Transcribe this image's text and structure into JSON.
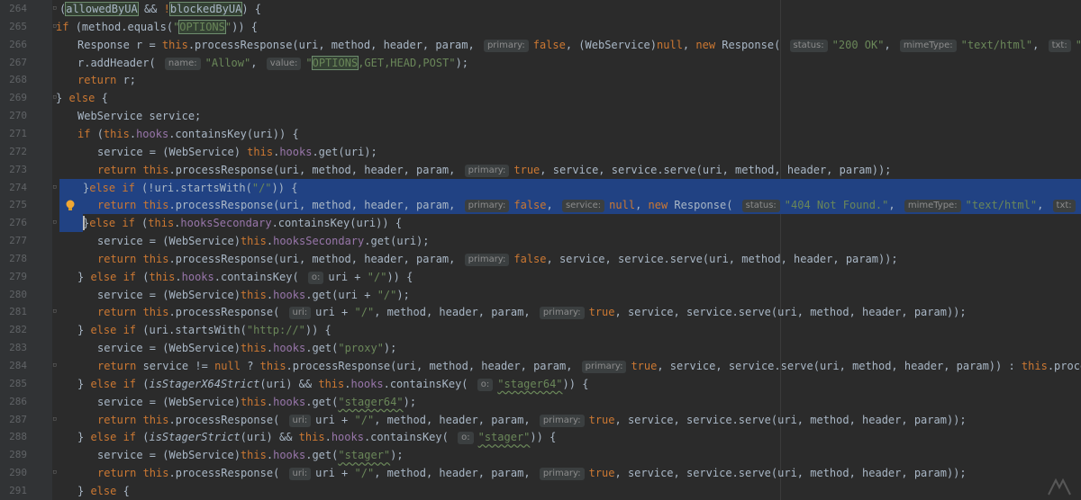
{
  "editor": {
    "lines": [
      {
        "num": "264",
        "t": [
          [
            "plain",
            "("
          ],
          [
            "boxed",
            "allowedByUA"
          ],
          [
            "plain",
            " && "
          ],
          [
            "kw",
            "!"
          ],
          [
            "boxed",
            "blockedByUA"
          ],
          [
            "plain",
            ") {"
          ]
        ]
      },
      {
        "num": "265",
        "t": [
          [
            "kw",
            "if "
          ],
          [
            "plain",
            "(method.equals("
          ],
          [
            "str",
            "\""
          ],
          [
            "str boxed",
            "OPTIONS"
          ],
          [
            "str",
            "\""
          ],
          [
            "plain",
            ")) {"
          ]
        ]
      },
      {
        "num": "266",
        "t": [
          [
            "plain",
            "Response r = "
          ],
          [
            "kw",
            "this"
          ],
          [
            "plain",
            ".processResponse(uri, method, header, param, "
          ],
          [
            "hint",
            "primary:"
          ],
          [
            "kw",
            "false"
          ],
          [
            "plain",
            ", ("
          ],
          [
            "plain",
            "WebService"
          ],
          [
            "plain",
            ")"
          ],
          [
            "kw",
            "null"
          ],
          [
            "plain",
            ", "
          ],
          [
            "kw",
            "new "
          ],
          [
            "plain",
            "Response( "
          ],
          [
            "hint",
            "status:"
          ],
          [
            "str",
            "\"200 OK\""
          ],
          [
            "plain",
            ", "
          ],
          [
            "hint",
            "mimeType:"
          ],
          [
            "str",
            "\"text/html\""
          ],
          [
            "plain",
            ", "
          ],
          [
            "hint",
            "txt:"
          ],
          [
            "str",
            "\"\""
          ],
          [
            "plain",
            "));"
          ]
        ]
      },
      {
        "num": "267",
        "t": [
          [
            "plain",
            "r.addHeader( "
          ],
          [
            "hint",
            "name:"
          ],
          [
            "str",
            "\"Allow\""
          ],
          [
            "plain",
            ", "
          ],
          [
            "hint",
            "value:"
          ],
          [
            "str",
            "\""
          ],
          [
            "str boxed",
            "OPTIONS"
          ],
          [
            "str",
            ",GET,HEAD,POST\""
          ],
          [
            "plain",
            ");"
          ]
        ]
      },
      {
        "num": "268",
        "t": [
          [
            "kw",
            "return "
          ],
          [
            "plain",
            "r;"
          ]
        ]
      },
      {
        "num": "269",
        "t": [
          [
            "plain",
            "} "
          ],
          [
            "kw",
            "else "
          ],
          [
            "plain",
            "{"
          ]
        ]
      },
      {
        "num": "270",
        "t": [
          [
            "plain",
            "WebService service;"
          ]
        ]
      },
      {
        "num": "271",
        "t": [
          [
            "kw",
            "if "
          ],
          [
            "plain",
            "("
          ],
          [
            "kw",
            "this"
          ],
          [
            "plain",
            "."
          ],
          [
            "fld",
            "hooks"
          ],
          [
            "plain",
            ".containsKey(uri)) {"
          ]
        ]
      },
      {
        "num": "272",
        "t": [
          [
            "plain",
            "service = (WebService) "
          ],
          [
            "kw",
            "this"
          ],
          [
            "plain",
            "."
          ],
          [
            "fld",
            "hooks"
          ],
          [
            "plain",
            ".get(uri);"
          ]
        ]
      },
      {
        "num": "273",
        "t": [
          [
            "kw",
            "return this"
          ],
          [
            "plain",
            ".processResponse(uri, method, header, param, "
          ],
          [
            "hint",
            "primary:"
          ],
          [
            "kw",
            "true"
          ],
          [
            "plain",
            ", service, service.serve(uri, method, header, param));"
          ]
        ]
      },
      {
        "num": "274",
        "t": [
          [
            "plain",
            "}"
          ],
          [
            "kw",
            "else if "
          ],
          [
            "plain",
            "(!uri.startsWith("
          ],
          [
            "str",
            "\"/\""
          ],
          [
            "plain",
            ")) {"
          ]
        ]
      },
      {
        "num": "275",
        "t": [
          [
            "kw",
            "return this"
          ],
          [
            "plain",
            ".processResponse(uri, method, header, param, "
          ],
          [
            "hint",
            "primary:"
          ],
          [
            "kw",
            "false"
          ],
          [
            "plain",
            ", "
          ],
          [
            "hint",
            "service:"
          ],
          [
            "kw",
            "null"
          ],
          [
            "plain",
            ", "
          ],
          [
            "kw",
            "new "
          ],
          [
            "plain",
            "Response( "
          ],
          [
            "hint",
            "status:"
          ],
          [
            "str",
            "\"404 Not Found.\""
          ],
          [
            "plain",
            ", "
          ],
          [
            "hint",
            "mimeType:"
          ],
          [
            "str",
            "\"text/html\""
          ],
          [
            "plain",
            ", "
          ],
          [
            "hint",
            "txt:"
          ],
          [
            "str",
            "\"\""
          ],
          [
            "plain",
            "));"
          ]
        ]
      },
      {
        "num": "276",
        "t": [
          [
            "plain",
            "}"
          ],
          [
            "kw",
            "else if "
          ],
          [
            "plain",
            "("
          ],
          [
            "kw",
            "this"
          ],
          [
            "plain",
            "."
          ],
          [
            "fld",
            "hooksSecondary"
          ],
          [
            "plain",
            ".containsKey(uri)) {"
          ]
        ]
      },
      {
        "num": "277",
        "t": [
          [
            "plain",
            "service = (WebService)"
          ],
          [
            "kw",
            "this"
          ],
          [
            "plain",
            "."
          ],
          [
            "fld",
            "hooksSecondary"
          ],
          [
            "plain",
            ".get(uri);"
          ]
        ]
      },
      {
        "num": "278",
        "t": [
          [
            "kw",
            "return this"
          ],
          [
            "plain",
            ".processResponse(uri, method, header, param, "
          ],
          [
            "hint",
            "primary:"
          ],
          [
            "kw",
            "false"
          ],
          [
            "plain",
            ", service, service.serve(uri, method, header, param));"
          ]
        ]
      },
      {
        "num": "279",
        "t": [
          [
            "plain",
            "} "
          ],
          [
            "kw",
            "else if "
          ],
          [
            "plain",
            "("
          ],
          [
            "kw",
            "this"
          ],
          [
            "plain",
            "."
          ],
          [
            "fld",
            "hooks"
          ],
          [
            "plain",
            ".containsKey( "
          ],
          [
            "hint",
            "o:"
          ],
          [
            "plain",
            "uri + "
          ],
          [
            "str",
            "\"/\""
          ],
          [
            "plain",
            ")) {"
          ]
        ]
      },
      {
        "num": "280",
        "t": [
          [
            "plain",
            "service = (WebService)"
          ],
          [
            "kw",
            "this"
          ],
          [
            "plain",
            "."
          ],
          [
            "fld",
            "hooks"
          ],
          [
            "plain",
            ".get(uri + "
          ],
          [
            "str",
            "\"/\""
          ],
          [
            "plain",
            ");"
          ]
        ]
      },
      {
        "num": "281",
        "t": [
          [
            "kw",
            "return this"
          ],
          [
            "plain",
            ".processResponse( "
          ],
          [
            "hint",
            "uri:"
          ],
          [
            "plain",
            "uri + "
          ],
          [
            "str",
            "\"/\""
          ],
          [
            "plain",
            ", method, header, param, "
          ],
          [
            "hint",
            "primary:"
          ],
          [
            "kw",
            "true"
          ],
          [
            "plain",
            ", service, service.serve(uri, method, header, param));"
          ]
        ]
      },
      {
        "num": "282",
        "t": [
          [
            "plain",
            "} "
          ],
          [
            "kw",
            "else if "
          ],
          [
            "plain",
            "(uri.startsWith("
          ],
          [
            "str",
            "\"http://\""
          ],
          [
            "plain",
            ")) {"
          ]
        ]
      },
      {
        "num": "283",
        "t": [
          [
            "plain",
            "service = (WebService)"
          ],
          [
            "kw",
            "this"
          ],
          [
            "plain",
            "."
          ],
          [
            "fld",
            "hooks"
          ],
          [
            "plain",
            ".get("
          ],
          [
            "str",
            "\"proxy\""
          ],
          [
            "plain",
            ");"
          ]
        ]
      },
      {
        "num": "284",
        "t": [
          [
            "kw",
            "return "
          ],
          [
            "plain",
            "service != "
          ],
          [
            "kw",
            "null "
          ],
          [
            "plain",
            "? "
          ],
          [
            "kw",
            "this"
          ],
          [
            "plain",
            ".processResponse(uri, method, header, param, "
          ],
          [
            "hint",
            "primary:"
          ],
          [
            "kw",
            "true"
          ],
          [
            "plain",
            ", service, service.serve(uri, method, header, param)) : "
          ],
          [
            "kw",
            "this"
          ],
          [
            "plain",
            ".proce"
          ]
        ]
      },
      {
        "num": "285",
        "t": [
          [
            "plain",
            "} "
          ],
          [
            "kw",
            "else if "
          ],
          [
            "plain",
            "("
          ],
          [
            "ital",
            "isStagerX64Strict"
          ],
          [
            "plain",
            "(uri) && "
          ],
          [
            "kw",
            "this"
          ],
          [
            "plain",
            "."
          ],
          [
            "fld",
            "hooks"
          ],
          [
            "plain",
            ".containsKey( "
          ],
          [
            "hint",
            "o:"
          ],
          [
            "str wavy",
            "\"stager64\""
          ],
          [
            "plain",
            ")) {"
          ]
        ]
      },
      {
        "num": "286",
        "t": [
          [
            "plain",
            "service = (WebService)"
          ],
          [
            "kw",
            "this"
          ],
          [
            "plain",
            "."
          ],
          [
            "fld",
            "hooks"
          ],
          [
            "plain",
            ".get("
          ],
          [
            "str wavy",
            "\"stager64\""
          ],
          [
            "plain",
            ");"
          ]
        ]
      },
      {
        "num": "287",
        "t": [
          [
            "kw",
            "return this"
          ],
          [
            "plain",
            ".processResponse( "
          ],
          [
            "hint",
            "uri:"
          ],
          [
            "plain",
            "uri + "
          ],
          [
            "str",
            "\"/\""
          ],
          [
            "plain",
            ", method, header, param, "
          ],
          [
            "hint",
            "primary:"
          ],
          [
            "kw",
            "true"
          ],
          [
            "plain",
            ", service, service.serve(uri, method, header, param));"
          ]
        ]
      },
      {
        "num": "288",
        "t": [
          [
            "plain",
            "} "
          ],
          [
            "kw",
            "else if "
          ],
          [
            "plain",
            "("
          ],
          [
            "ital",
            "isStagerStrict"
          ],
          [
            "plain",
            "(uri) && "
          ],
          [
            "kw",
            "this"
          ],
          [
            "plain",
            "."
          ],
          [
            "fld",
            "hooks"
          ],
          [
            "plain",
            ".containsKey( "
          ],
          [
            "hint",
            "o:"
          ],
          [
            "str wavy",
            "\"stager\""
          ],
          [
            "plain",
            ")) {"
          ]
        ]
      },
      {
        "num": "289",
        "t": [
          [
            "plain",
            "service = (WebService)"
          ],
          [
            "kw",
            "this"
          ],
          [
            "plain",
            "."
          ],
          [
            "fld",
            "hooks"
          ],
          [
            "plain",
            ".get("
          ],
          [
            "str wavy",
            "\"stager\""
          ],
          [
            "plain",
            ");"
          ]
        ]
      },
      {
        "num": "290",
        "t": [
          [
            "kw",
            "return this"
          ],
          [
            "plain",
            ".processResponse( "
          ],
          [
            "hint",
            "uri:"
          ],
          [
            "plain",
            "uri + "
          ],
          [
            "str",
            "\"/\""
          ],
          [
            "plain",
            ", method, header, param, "
          ],
          [
            "hint",
            "primary:"
          ],
          [
            "kw",
            "true"
          ],
          [
            "plain",
            ", service, service.serve(uri, method, header, param));"
          ]
        ]
      },
      {
        "num": "291",
        "t": [
          [
            "plain",
            "} "
          ],
          [
            "kw",
            "else "
          ],
          [
            "plain",
            "{"
          ]
        ]
      }
    ]
  }
}
